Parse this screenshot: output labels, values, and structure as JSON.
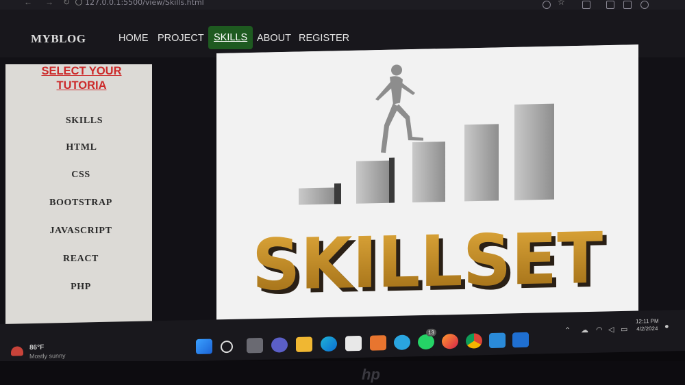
{
  "browser": {
    "url": "127.0.0.1:5500/view/Skills.html"
  },
  "nav": {
    "brand": "MYBLOG",
    "links": [
      "HOME",
      "PROJECT",
      "SKILLS",
      "ABOUT",
      "REGISTER"
    ],
    "active": "SKILLS"
  },
  "sidebar": {
    "title_line1": "SELECT YOUR",
    "title_line2": "TUTORIA",
    "items": [
      "SKILLS",
      "HTML",
      "CSS",
      "BOOTSTRAP",
      "JAVASCRIPT",
      "REACT",
      "PHP"
    ]
  },
  "hero": {
    "word": "SKILLSET"
  },
  "taskbar": {
    "weather_temp": "86°F",
    "weather_desc": "Mostly sunny",
    "whatsapp_badge": "13",
    "time": "12:11 PM",
    "date": "4/2/2024"
  },
  "colors": {
    "accent_green": "#1e5a20",
    "title_red": "#cc2a2a",
    "gold": "#c8912c"
  }
}
